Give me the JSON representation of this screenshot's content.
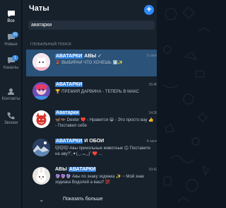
{
  "rail": {
    "items": [
      {
        "label": "Все",
        "icon": "chat-bubble-icon",
        "active": true
      },
      {
        "label": "Новые",
        "icon": "new-chats-icon",
        "badge": "31"
      },
      {
        "label": "Каналы",
        "icon": "channels-icon",
        "badge": "1"
      },
      {
        "label": "Контакты",
        "icon": "contacts-icon"
      },
      {
        "label": "Звонки",
        "icon": "calls-icon"
      }
    ]
  },
  "header": {
    "title": "Чаты",
    "compose": "+"
  },
  "search": {
    "value": "аватарки"
  },
  "section": {
    "label": "ГЛОБАЛЬНЫЙ ПОИСК"
  },
  "results": [
    {
      "name_hl": "АВАТАРКИ",
      "name_rest": " АВЫ ✓",
      "time": "3 сент.",
      "msg": "💄 ВЫБИРАЙ ЧТО ХОЧЕШЬ ⬇️✨"
    },
    {
      "name_hl": "АВАТАРКИ",
      "name_rest": "",
      "time": "15:45",
      "msg": "🏆 ПРЕМИЯ ДАРВИНА - ТЕПЕРЬ В МАКС"
    },
    {
      "name_hl": "Аватарки",
      "name_rest": "",
      "time": "14:38",
      "msg": "🦋🦇 Dexter ❤️ - Нравится 😁 - Это просто вау 👍 - Поставил себе"
    },
    {
      "name_hl": "АВАТАРКИ",
      "name_rest": " И ОБОИ",
      "time": "4 сент.",
      "msg": "🐱🐱🐱 Авы прикольные животные 😊 Поставите на аву?˚,✦(◡ ᴗ◡)˚ ❤️ ..."
    },
    {
      "name_pre": "АВЫ ",
      "name_hl": "АВАТАРКИ",
      "time": "10:42",
      "msg": "🔮🔮🔮 Авы по знаку зодиака ✨ ~ Мой знак зодиака Водолей а ваш? 💯"
    }
  ],
  "more": {
    "label": "Показать больше"
  },
  "colors": {
    "accent": "#2f89f5",
    "selected_bg": "#2b5278",
    "panel_bg": "#17212b",
    "highlight": "#2f7ed8"
  }
}
